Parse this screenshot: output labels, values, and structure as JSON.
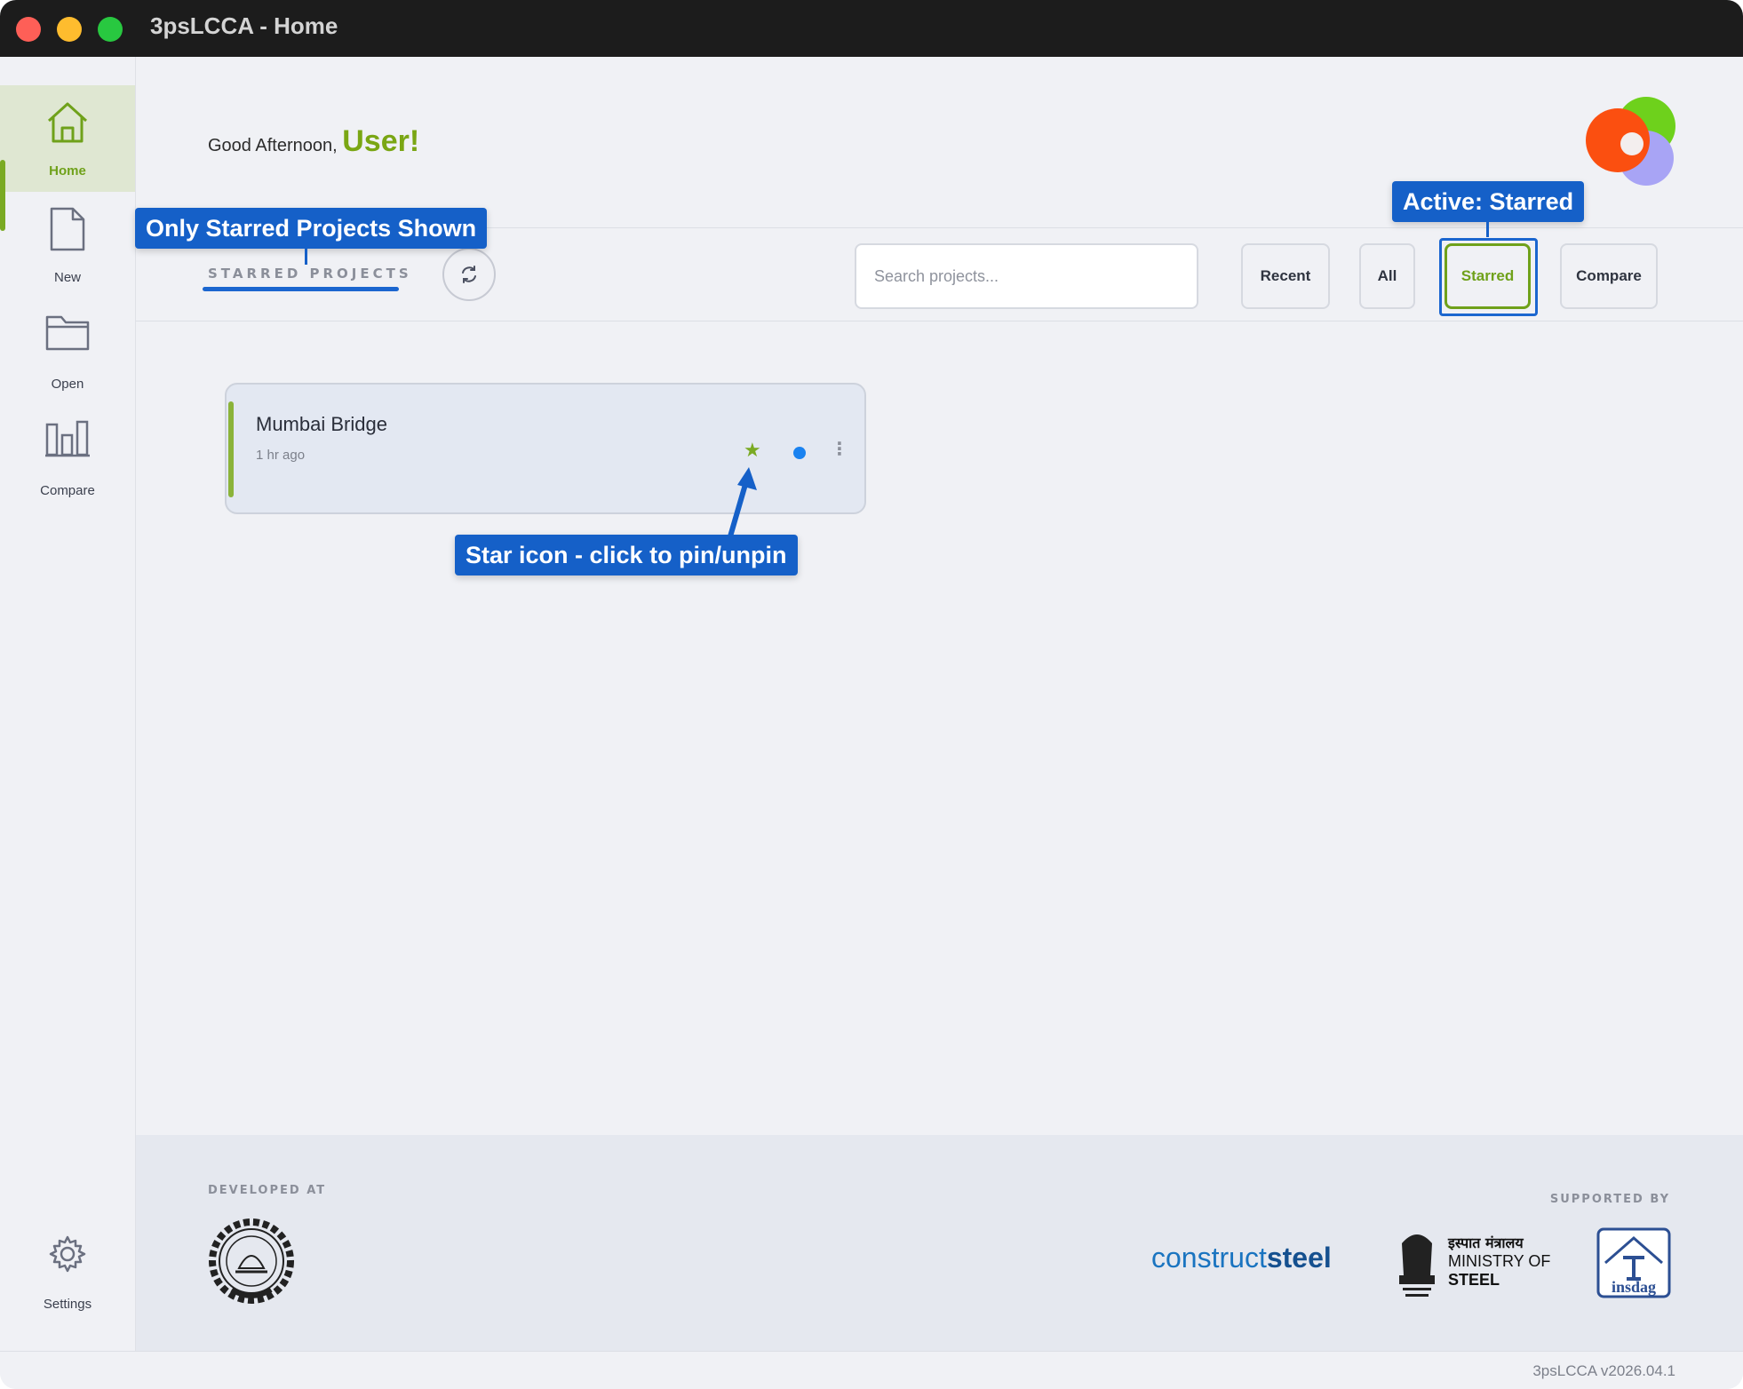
{
  "window": {
    "title": "3psLCCA - Home"
  },
  "sidebar": {
    "items": [
      {
        "label": "Home",
        "icon": "home-icon",
        "active": true
      },
      {
        "label": "New",
        "icon": "file-icon"
      },
      {
        "label": "Open",
        "icon": "folder-icon"
      },
      {
        "label": "Compare",
        "icon": "bar-chart-icon"
      }
    ],
    "settings_label": "Settings"
  },
  "header": {
    "greeting": "Good Afternoon,",
    "user_name": "User!"
  },
  "toolbar": {
    "section_title": "STARRED PROJECTS",
    "search_placeholder": "Search projects...",
    "filters": {
      "recent": "Recent",
      "all": "All",
      "starred": "Starred",
      "compare": "Compare"
    },
    "active_filter": "Starred"
  },
  "projects": [
    {
      "name": "Mumbai Bridge",
      "time": "1 hr ago",
      "starred": true
    }
  ],
  "annotations": {
    "only_starred": "Only Starred Projects Shown",
    "active_starred": "Active: Starred",
    "star_icon": "Star icon - click to pin/unpin"
  },
  "footer": {
    "developed_at": "DEVELOPED AT",
    "supported_by": "SUPPORTED BY",
    "constructsteel_a": "construct",
    "constructsteel_b": "steel",
    "ministry_hindi": "इस्पात मंत्रालय",
    "ministry_line1": "MINISTRY OF",
    "ministry_line2": "STEEL"
  },
  "status": {
    "version": "3psLCCA v2026.04.1"
  },
  "colors": {
    "accent_green": "#7aaa23",
    "annotation_blue": "#1560c8",
    "status_dot": "#1a82f0"
  }
}
